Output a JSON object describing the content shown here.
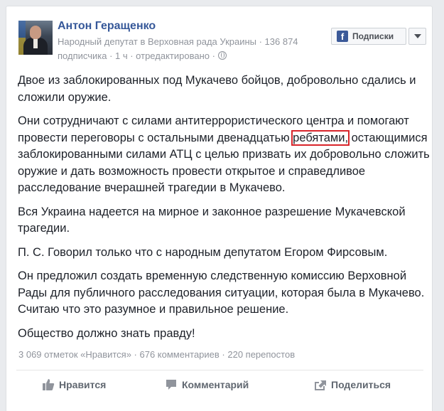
{
  "post": {
    "author": "Антон Геращенко",
    "meta_line1": "Народный депутат в Верховная рада Украины · 136 874",
    "meta_line2_prefix": "подписчика · 1 ч · отредактировано · ",
    "paragraphs": {
      "p1": "Двое из заблокированных под Мукачево бойцов, добровольно сдались и сложили оружие.",
      "p2_before": "Они сотрудничают с силами антитеррористического центра и помогают провести переговоры с остальными двенадцатью ",
      "p2_highlight": "ребятами,",
      "p2_after": " остающимися заблокированными силами АТЦ с целью призвать их добровольно сложить оружие и дать возможность провести открытое и справедливое расследование вчерашней трагедии в Мукачево.",
      "p3": "Вся Украина надеется на мирное и законное разрешение Мукачевской трагедии.",
      "p4": "П. С. Говорил только что с народным депутатом Егором Фирсовым.",
      "p5": "Он предложил создать временную следственную комиссию Верховной Рады для публичного расследования ситуации, которая была в Мукачево. Считаю что это разумное и правильное решение.",
      "p6": "Общество должно знать правду!"
    },
    "stats": "3 069 отметок «Нравится» · 676 комментариев · 220 перепостов"
  },
  "follow": {
    "label": "Подписки",
    "icon": "f"
  },
  "actions": {
    "like": "Нравится",
    "comment": "Комментарий",
    "share": "Поделиться"
  },
  "colors": {
    "link": "#365899",
    "meta": "#90949c",
    "highlight_box": "#d9252b",
    "facebook_blue": "#3b5998"
  }
}
